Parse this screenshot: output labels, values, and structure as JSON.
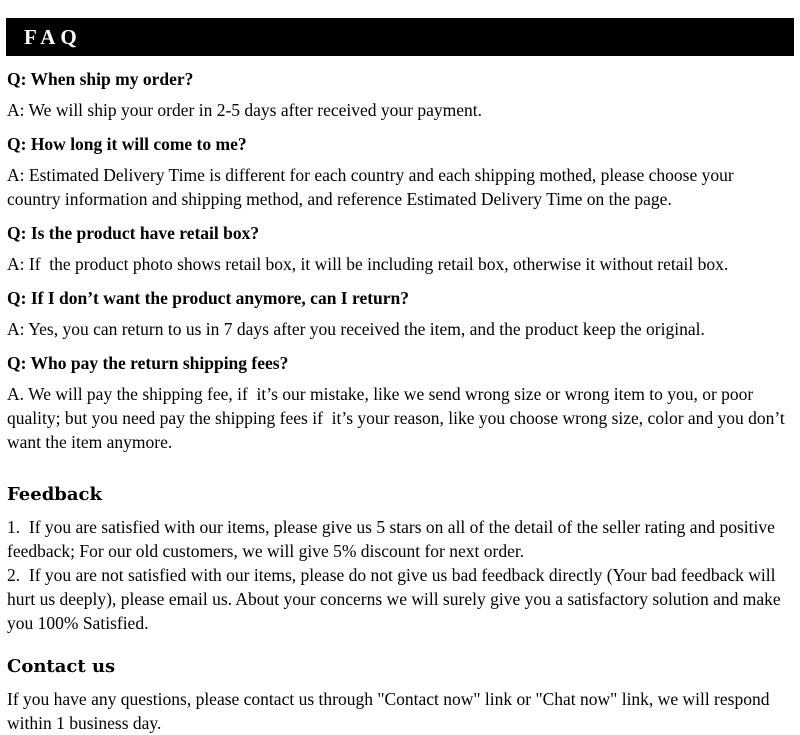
{
  "header": {
    "title": "FAQ"
  },
  "faq": {
    "items": [
      {
        "question": "Q: When ship my order?",
        "answer": "A: We will ship your order in 2-5 days after received your payment."
      },
      {
        "question": "Q: How long it will come to me?",
        "answer": "A: Estimated Delivery Time is different for each country and each shipping mothed, please choose your country information and shipping method, and reference Estimated Delivery Time on the page."
      },
      {
        "question": "Q: Is the product have retail box?",
        "answer": "A: If  the product photo shows retail box, it will be including retail box, otherwise it without retail box."
      },
      {
        "question": "Q: If I don’t want the product anymore, can I return?",
        "answer": "A: Yes, you can return to us in 7 days after you received the item, and the product keep the original."
      },
      {
        "question": "Q: Who pay the return shipping fees?",
        "answer": "A. We will pay the shipping fee, if  it’s our mistake, like we send wrong size or wrong item to you, or poor quality; but you need pay the shipping fees if  it’s your reason, like you choose wrong size, color and you don’t want the item anymore."
      }
    ]
  },
  "feedback": {
    "heading": "Feedback",
    "item_1": "1.  If you are satisfied with our items, please give us 5 stars on all of the detail of the seller rating and positive feedback; For our old customers, we will give 5% discount for next order.",
    "item_2": "2.  If you are not satisfied with our items, please do not give us bad feedback directly (Your bad feedback will hurt us deeply), please email us. About your concerns we will surely give you a satisfactory solution and make you 100% Satisfied."
  },
  "contact": {
    "heading": "Contact us",
    "body": "If you have any questions, please contact us through \"Contact now\" link or \"Chat now\" link, we will respond within 1 business day."
  },
  "colors": {
    "header_background": "#000000",
    "header_text": "#ffffff",
    "body_text": "#000000",
    "page_background": "#ffffff"
  }
}
